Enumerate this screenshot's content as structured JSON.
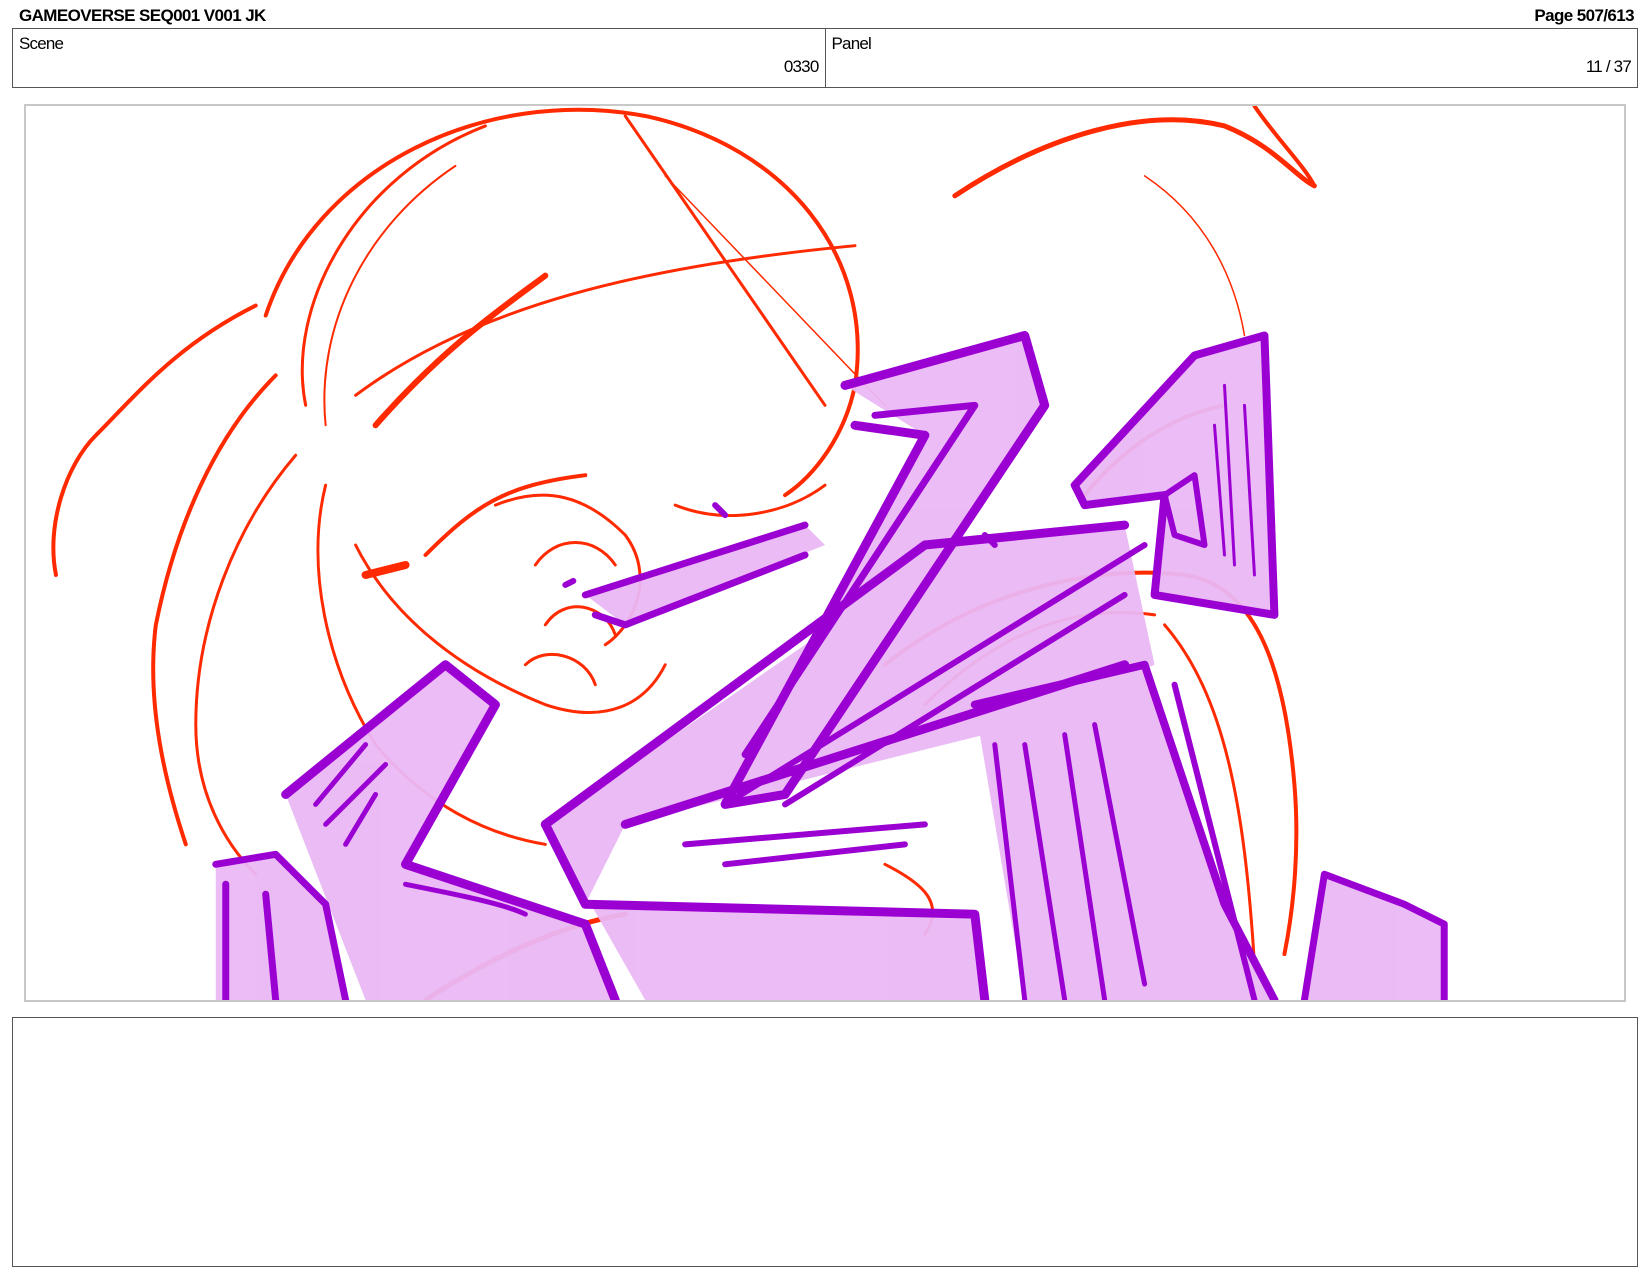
{
  "header": {
    "title": "GAMEOVERSE SEQ001 V001 JK",
    "page": "Page 507/613"
  },
  "scene": {
    "label": "Scene",
    "value": "0330"
  },
  "panel": {
    "label": "Panel",
    "value": "11 / 37"
  },
  "colors": {
    "sketch_red": "#ff2a00",
    "sketch_purple": "#9b00d3",
    "sketch_lilac": "#eab8f5",
    "frame_border": "#c8c8c8"
  },
  "notes": {
    "text": ""
  }
}
